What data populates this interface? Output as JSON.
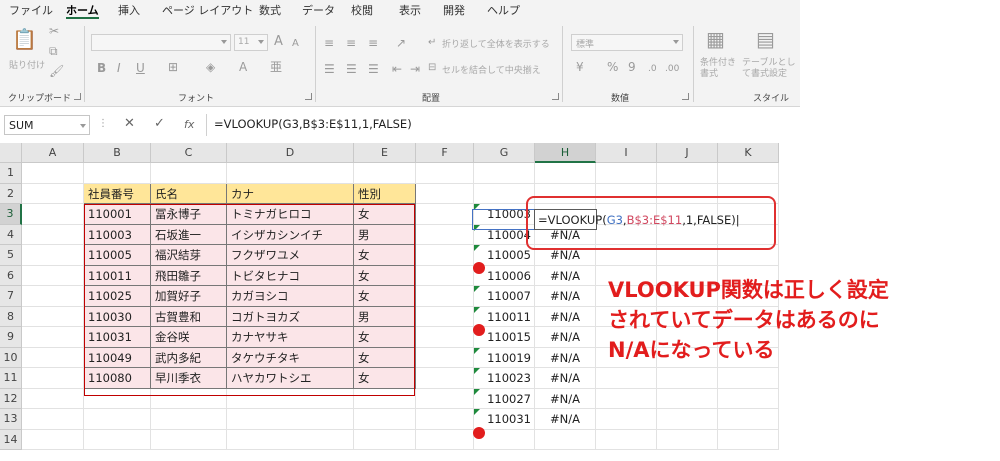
{
  "ribbon": {
    "tabs": [
      "ファイル",
      "ホーム",
      "挿入",
      "ページ レイアウト",
      "数式",
      "データ",
      "校閲",
      "表示",
      "開発",
      "ヘルプ"
    ],
    "active_tab": "ホーム",
    "clipboard": {
      "paste_label": "貼り付け",
      "group_label": "クリップボード"
    },
    "font": {
      "size": "11",
      "grow_label": "A",
      "shrink_label": "A",
      "bold": "B",
      "italic": "I",
      "underline": "U",
      "fontcolor_letter": "A",
      "phonetic_label": "亜",
      "group_label": "フォント"
    },
    "alignment": {
      "wrap_label": "折り返して全体を表示する",
      "merge_label": "セルを結合して中央揃え",
      "group_label": "配置"
    },
    "number": {
      "format": "標準",
      "percent": "%",
      "comma": "9",
      "group_label": "数値"
    },
    "styles": {
      "conditional_label": "条件付き書式",
      "table_label": "テーブルとして書式設定",
      "group_label": "スタイル"
    }
  },
  "formula_bar": {
    "name_box": "SUM",
    "dots": "⋮",
    "cancel": "✕",
    "enter": "✓",
    "fx": "fx",
    "formula": "=VLOOKUP(G3,B$3:E$11,1,FALSE)"
  },
  "grid": {
    "columns": [
      "A",
      "B",
      "C",
      "D",
      "E",
      "F",
      "G",
      "H",
      "I",
      "J",
      "K"
    ],
    "rows": [
      "1",
      "2",
      "3",
      "4",
      "5",
      "6",
      "7",
      "8",
      "9",
      "10",
      "11",
      "12",
      "13",
      "14"
    ],
    "table_headers": [
      "社員番号",
      "氏名",
      "カナ",
      "性別"
    ],
    "table_rows": [
      [
        "110001",
        "冨永博子",
        "トミナガヒロコ",
        "女"
      ],
      [
        "110003",
        "石坂進一",
        "イシザカシンイチ",
        "男"
      ],
      [
        "110005",
        "福沢結芽",
        "フクザワユメ",
        "女"
      ],
      [
        "110011",
        "飛田雛子",
        "トビタヒナコ",
        "女"
      ],
      [
        "110025",
        "加賀好子",
        "カガヨシコ",
        "女"
      ],
      [
        "110030",
        "古賀豊和",
        "コガトヨカズ",
        "男"
      ],
      [
        "110031",
        "金谷咲",
        "カナヤサキ",
        "女"
      ],
      [
        "110049",
        "武内多紀",
        "タケウチタキ",
        "女"
      ],
      [
        "110080",
        "早川季衣",
        "ハヤカワトシエ",
        "女"
      ]
    ],
    "lookup_ids": [
      "110003",
      "110004",
      "110005",
      "110006",
      "110007",
      "110011",
      "110015",
      "110019",
      "110023",
      "110027",
      "110031"
    ],
    "na_value": "#N/A",
    "editing_formula": {
      "start": "=VLOOKUP(",
      "arg1": "G3",
      "comma1": ",",
      "arg2": "B$3:E$11",
      "rest": ",1,FALSE)"
    }
  },
  "annotation": {
    "lines": [
      "VLOOKUP関数は正しく設定",
      "されていてデータはあるのに",
      "N/Aになっている"
    ],
    "color": "#e21d1d"
  }
}
